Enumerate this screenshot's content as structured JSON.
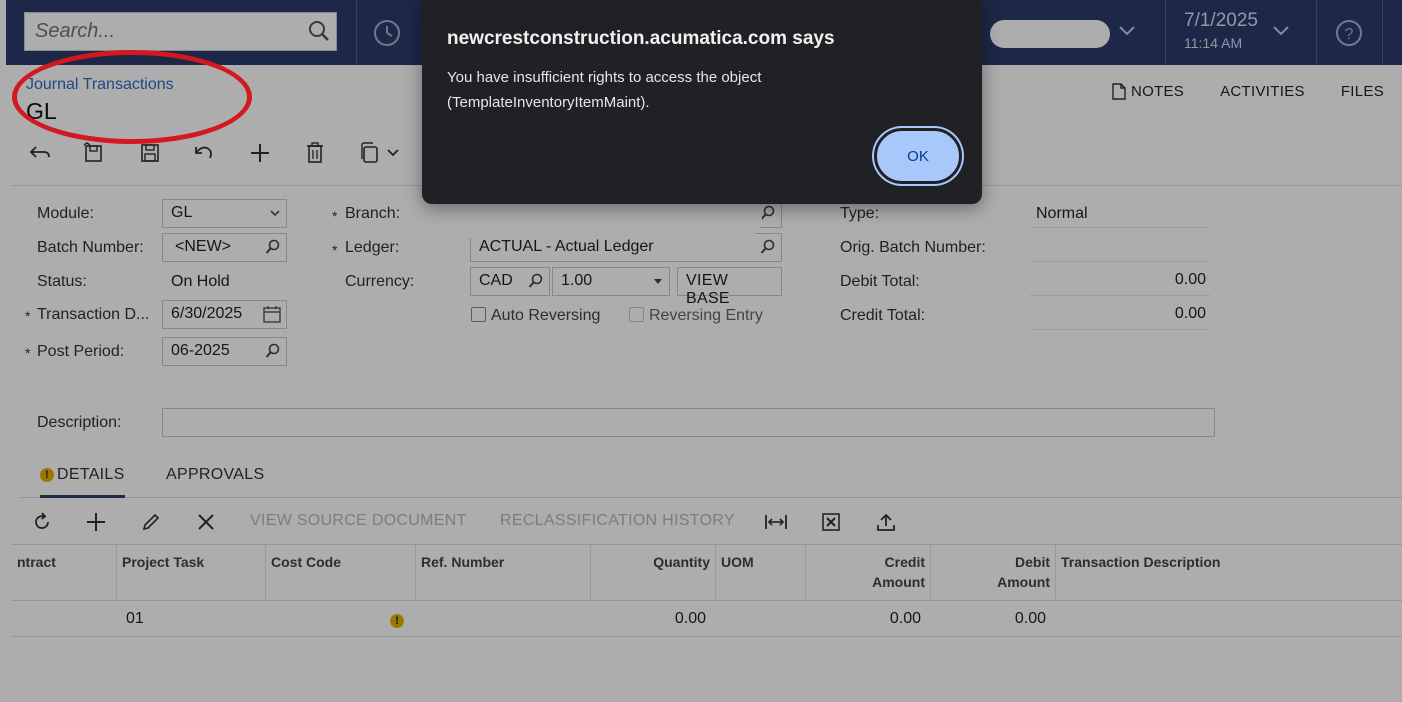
{
  "topbar": {
    "search_placeholder": "Search...",
    "date": "7/1/2025",
    "time": "11:14 AM"
  },
  "header": {
    "breadcrumb": "Journal Transactions",
    "title": "GL",
    "actions": {
      "notes": "NOTES",
      "activities": "ACTIVITIES",
      "files": "FILES"
    }
  },
  "form": {
    "labels": {
      "module": "Module:",
      "batch_number": "Batch Number:",
      "status": "Status:",
      "transaction_date": "Transaction D...",
      "post_period": "Post Period:",
      "branch": "Branch:",
      "ledger": "Ledger:",
      "currency": "Currency:",
      "type": "Type:",
      "orig_batch": "Orig. Batch Number:",
      "debit_total": "Debit Total:",
      "credit_total": "Credit Total:",
      "description": "Description:",
      "auto_reversing": "Auto Reversing",
      "reversing_entry": "Reversing Entry"
    },
    "values": {
      "module": "GL",
      "batch_number": "<NEW>",
      "status": "On Hold",
      "transaction_date": "6/30/2025",
      "post_period": "06-2025",
      "ledger": "ACTUAL - Actual Ledger",
      "currency": "CAD",
      "rate": "1.00",
      "type": "Normal",
      "debit_total": "0.00",
      "credit_total": "0.00"
    },
    "view_base_label": "VIEW BASE",
    "required_mark": "*"
  },
  "tabs": {
    "details": "DETAILS",
    "approvals": "APPROVALS"
  },
  "grid_toolbar": {
    "view_source": "VIEW SOURCE DOCUMENT",
    "reclass_history": "RECLASSIFICATION HISTORY"
  },
  "grid": {
    "headers": {
      "contract": "ntract",
      "project_task": "Project Task",
      "cost_code": "Cost Code",
      "ref_number": "Ref. Number",
      "quantity": "Quantity",
      "uom": "UOM",
      "credit_amount_1": "Credit",
      "credit_amount_2": "Amount",
      "debit_amount_1": "Debit",
      "debit_amount_2": "Amount",
      "transaction_description": "Transaction Description"
    },
    "row": {
      "project_task": "01",
      "warning": "!",
      "quantity": "0.00",
      "credit": "0.00",
      "debit": "0.00"
    }
  },
  "dialog": {
    "title": "newcrestconstruction.acumatica.com says",
    "message": "You have insufficient rights to access the object (TemplateInventoryItemMaint).",
    "ok_label": "OK"
  },
  "colors": {
    "topbar": "#2c3a69",
    "link": "#2c6fbb",
    "annotation": "#d31820",
    "dialog_bg": "#202124",
    "ok_button": "#a8c7fa"
  }
}
